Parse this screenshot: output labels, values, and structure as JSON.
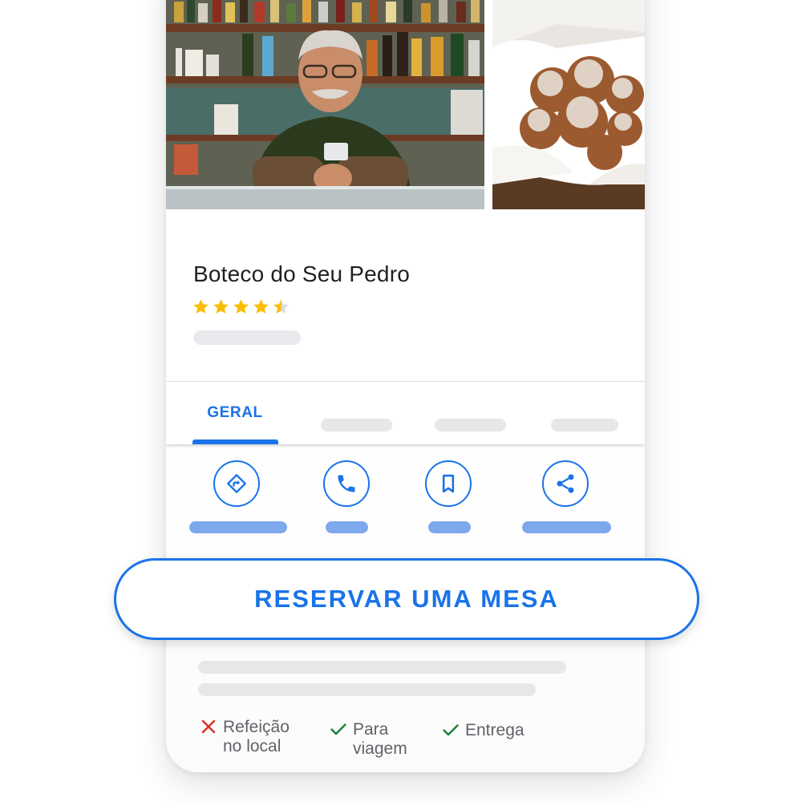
{
  "place": {
    "name": "Boteco do Seu Pedro",
    "rating_stars": 4.5
  },
  "photos": [
    {
      "icon": "photo-owner-at-bar"
    },
    {
      "icon": "photo-sugared-pastries"
    }
  ],
  "tabs": {
    "active_label": "GERAL"
  },
  "actions": [
    {
      "icon": "directions-icon"
    },
    {
      "icon": "phone-icon"
    },
    {
      "icon": "bookmark-icon"
    },
    {
      "icon": "share-icon"
    }
  ],
  "reserve_button": {
    "label": "RESERVAR UMA MESA"
  },
  "attributes": [
    {
      "icon": "close-icon",
      "line1": "Refeição",
      "line2": "no local",
      "available": false
    },
    {
      "icon": "check-icon",
      "line1": "Para",
      "line2": "viagem",
      "available": true
    },
    {
      "icon": "check-icon",
      "line1": "Entrega",
      "line2": "",
      "available": true
    }
  ],
  "colors": {
    "accent": "#1a73e8",
    "star": "#fbbc04",
    "unavailable": "#d93025",
    "available": "#188038",
    "skeleton": "#e6e7e9",
    "skeleton_accent": "#7ea8ec"
  }
}
